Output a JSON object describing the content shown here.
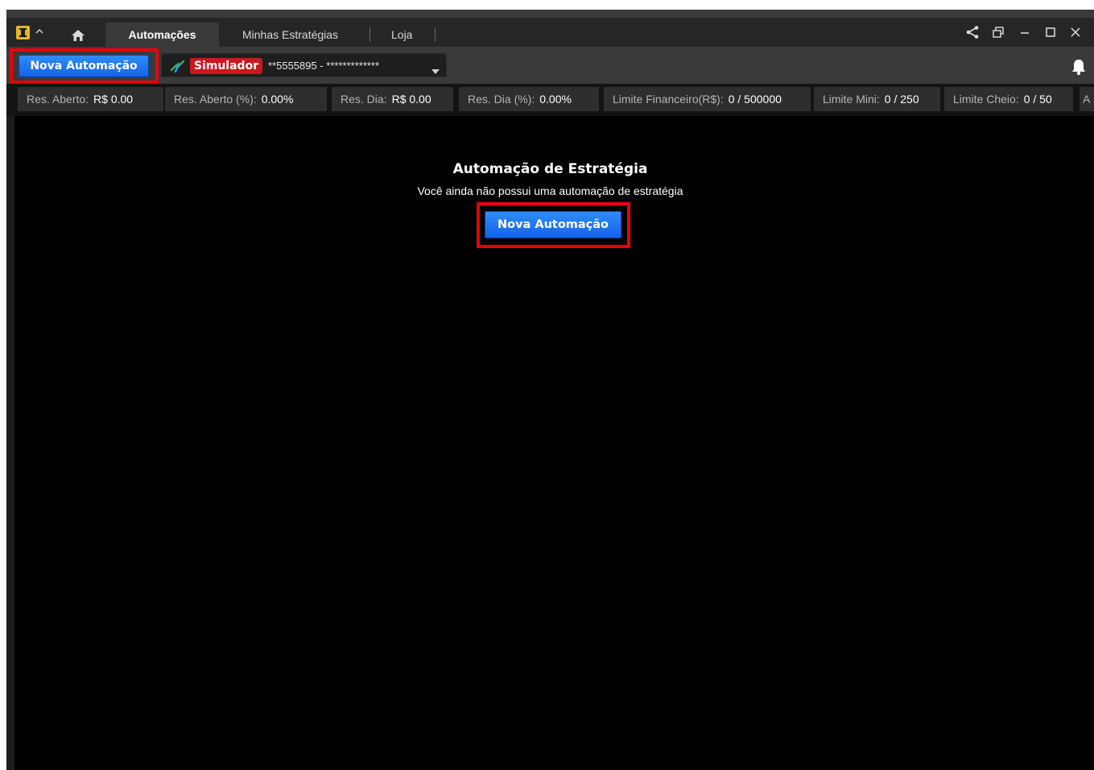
{
  "tabs": [
    {
      "label": "Automações"
    },
    {
      "label": "Minhas Estratégias"
    },
    {
      "label": "Loja"
    }
  ],
  "toolbar": {
    "new_automation_label": "Nova Automação",
    "simulator_badge": "Simulador",
    "account_text": "**5555895 - *************"
  },
  "stats": [
    {
      "label": "Res. Aberto:",
      "value": "R$ 0.00"
    },
    {
      "label": "Res. Aberto (%):",
      "value": "0.00%"
    },
    {
      "label": "Res. Dia:",
      "value": "R$ 0.00"
    },
    {
      "label": "Res. Dia (%):",
      "value": "0.00%"
    },
    {
      "label": "Limite Financeiro(R$):",
      "value": "0 / 500000"
    },
    {
      "label": "Limite Mini:",
      "value": "0 / 250"
    },
    {
      "label": "Limite Cheio:",
      "value": "0 / 50"
    },
    {
      "label": "A",
      "value": ""
    }
  ],
  "empty_state": {
    "title": "Automação de Estratégia",
    "subtitle": "Você ainda não possui uma automação de estratégia",
    "button_label": "Nova Automação"
  },
  "colors": {
    "accent_blue": "#1463e8",
    "highlight_red": "#e8000b",
    "simulator_red": "#c8191f",
    "logo_yellow": "#e2b629"
  },
  "icons": [
    "logo-icon",
    "caret-up-icon",
    "home-icon",
    "share-icon",
    "restore-window-icon",
    "minimize-icon",
    "maximize-icon",
    "close-icon",
    "bolt-icon",
    "dropdown-caret-icon",
    "bell-icon"
  ]
}
